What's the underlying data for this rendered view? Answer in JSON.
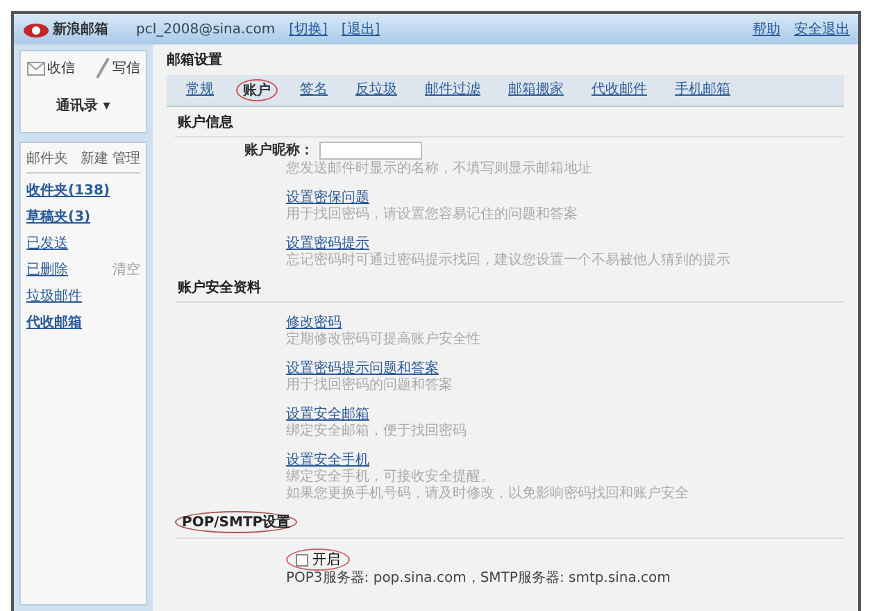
{
  "header": {
    "logo": "新浪邮箱",
    "account": "pcl_2008@sina.com",
    "links": [
      "[切换]",
      "[退出]"
    ],
    "right_links": [
      "帮助",
      "安全退出"
    ]
  },
  "sidebar": {
    "actions": [
      {
        "label": "收信",
        "kind": "receive"
      },
      {
        "label": "写信",
        "kind": "write"
      }
    ],
    "contacts": "通讯录 ▾",
    "folder_header": "邮件夹",
    "folder_actions": [
      "新建",
      "管理"
    ],
    "folders": [
      {
        "label": "收件夹(138)",
        "bold": true
      },
      {
        "label": "草稿夹(3)",
        "bold": true
      },
      {
        "label": "已发送",
        "bold": false
      },
      {
        "label": "已删除",
        "bold": false,
        "extra": "清空"
      },
      {
        "label": "垃圾邮件",
        "bold": false
      },
      {
        "label": "代收邮箱",
        "bold": true
      }
    ]
  },
  "page_title": "邮箱设置",
  "tabs": [
    {
      "label": "常规",
      "selected": false
    },
    {
      "label": "账户",
      "selected": true
    },
    {
      "label": "签名",
      "selected": false
    },
    {
      "label": "反垃圾",
      "selected": false
    },
    {
      "label": "邮件过滤",
      "selected": false
    },
    {
      "label": "邮箱搬家",
      "selected": false
    },
    {
      "label": "代收邮件",
      "selected": false
    },
    {
      "label": "手机邮箱",
      "selected": false
    }
  ],
  "sections": [
    {
      "title": "账户信息",
      "circled": false,
      "field": {
        "label": "账户昵称："
      },
      "items": [
        {
          "kind": "hint",
          "desc": [
            "您发送邮件时显示的名称，不填写则显示邮箱地址"
          ]
        },
        {
          "kind": "link",
          "link": "设置密保问题",
          "desc": [
            "用于找回密码，请设置您容易记住的问题和答案"
          ]
        },
        {
          "kind": "link",
          "link": "设置密码提示",
          "desc": [
            "忘记密码时可通过密码提示找回，建议您设置一个不易被他人猜到的提示"
          ]
        }
      ]
    },
    {
      "title": "账户安全资料",
      "circled": false,
      "items": [
        {
          "kind": "link",
          "link": "修改密码",
          "desc": [
            "定期修改密码可提高账户安全性"
          ]
        },
        {
          "kind": "link",
          "link": "设置密码提示问题和答案",
          "desc": [
            "用于找回密码的问题和答案"
          ]
        },
        {
          "kind": "link",
          "link": "设置安全邮箱",
          "desc": [
            "绑定安全邮箱，便于找回密码"
          ]
        },
        {
          "kind": "link",
          "link": "设置安全手机",
          "desc": [
            "绑定安全手机，可接收安全提醒。",
            "如果您更换手机号码，请及时修改，以免影响密码找回和账户安全"
          ]
        }
      ]
    },
    {
      "title": "POP/SMTP设置",
      "circled": true,
      "pop": {
        "checked": false,
        "label": "开启",
        "servers": "POP3服务器: pop.sina.com，SMTP服务器: smtp.sina.com"
      }
    }
  ]
}
